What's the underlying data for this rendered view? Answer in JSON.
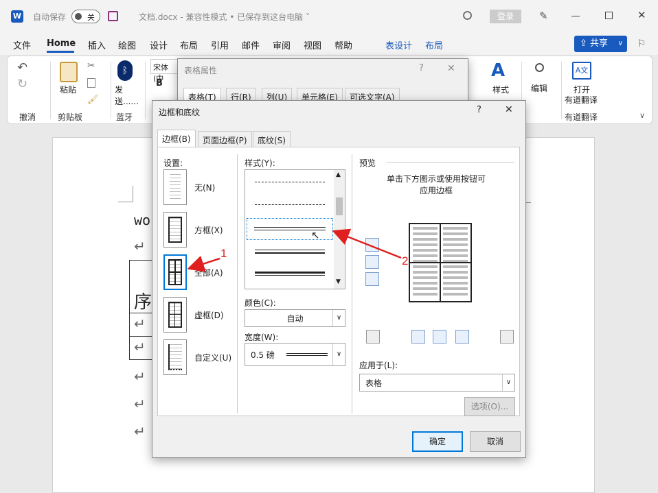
{
  "titlebar": {
    "autosave_label": "自动保存",
    "autosave_state": "关",
    "doc_title": "文档.docx  -  兼容性模式 • 已保存到这台电脑 ˅",
    "login_label": "登录"
  },
  "menu": {
    "items": [
      "文件",
      "Home",
      "插入",
      "绘图",
      "设计",
      "布局",
      "引用",
      "邮件",
      "审阅",
      "视图",
      "帮助"
    ],
    "context_items": [
      "表设计",
      "布局"
    ],
    "share_label": "共享"
  },
  "ribbon": {
    "undo_group": "撤消",
    "paste_label": "粘贴",
    "clipboard_group": "剪贴板",
    "send_label": "发送......",
    "bluetooth_group": "蓝牙",
    "font_name": "宋体 (中",
    "bold": "B",
    "styles_label": "样式",
    "edit_label": "编辑",
    "open_label": "打开",
    "youdao_label": "有道翻译",
    "youdao_group": "有道翻译"
  },
  "document": {
    "text_fragment": "wo",
    "cell_text": "序",
    "return_mark": "↵"
  },
  "table_props_dialog": {
    "title": "表格属性",
    "tabs": [
      "表格(T)",
      "行(R)",
      "列(U)",
      "单元格(E)",
      "可选文字(A)"
    ]
  },
  "borders_dialog": {
    "title": "边框和底纹",
    "help": "?",
    "close": "✕",
    "tabs": [
      "边框(B)",
      "页面边框(P)",
      "底纹(S)"
    ],
    "settings_label": "设置:",
    "settings": [
      "无(N)",
      "方框(X)",
      "全部(A)",
      "虚框(D)",
      "自定义(U)"
    ],
    "style_label": "样式(Y):",
    "color_label": "颜色(C):",
    "color_value": "自动",
    "width_label": "宽度(W):",
    "width_value": "0.5 磅",
    "preview_label": "预览",
    "preview_hint": "单击下方图示或使用按钮可应用边框",
    "apply_label": "应用于(L):",
    "apply_value": "表格",
    "options_btn": "选项(O)...",
    "ok_btn": "确定",
    "cancel_btn": "取消"
  },
  "annotations": {
    "marker1": "1",
    "marker2": "2",
    "arrow_color": "#e02020"
  }
}
